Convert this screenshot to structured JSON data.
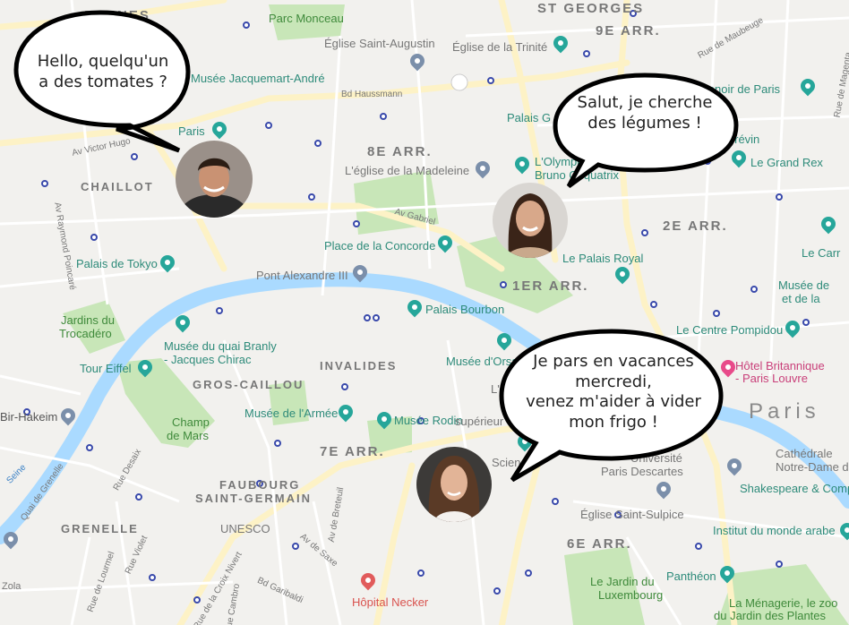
{
  "districts": {
    "ternes": "TERNES",
    "st_georges": "ST GEORGES",
    "arr9": "9E ARR.",
    "arr8": "8E ARR.",
    "chaillot": "CHAILLOT",
    "arr2": "2E ARR.",
    "arr1": "1ER ARR.",
    "invalides": "INVALIDES",
    "gros_caillou": "GROS-CAILLOU",
    "arr7": "7E ARR.",
    "faubourg1": "FAUBOURG",
    "faubourg2": "SAINT-GERMAIN",
    "grenelle": "GRENELLE",
    "arr6": "6E ARR.",
    "paris": "Paris"
  },
  "pois": {
    "parc_monceau": "Parc Monceau",
    "eglise_st_augustin": "Église Saint-Augustin",
    "eglise_trinite": "Église de la Trinité",
    "musee_jacquemart": "Musée Jacquemart-André",
    "bd_haussmann": "Bd Haussmann",
    "opera": "Palais G",
    "madeleine": "L'église de la Madeleine",
    "olympia1": "L'Olympia",
    "olympia2": "Bruno Coquatrix",
    "grevin": "Grévin",
    "grand_rex": "Le Grand Rex",
    "manoir": "Manoir de Paris",
    "place_concorde": "Place de la Concorde",
    "palais_royal": "Le Palais Royal",
    "palais_tokyo": "Palais de Tokyo",
    "pont_alexandre": "Pont Alexandre III",
    "palais_bourbon": "Palais Bourbon",
    "jardins_troca1": "Jardins du",
    "jardins_troca2": "Trocadéro",
    "quai_branly1": "Musée du quai Branly",
    "quai_branly2": "- Jacques Chirac",
    "musee_orsay": "Musée d'Orsay",
    "tour_eiffel": "Tour Eiffel",
    "centre_pompidou": "Le Centre Pompidou",
    "hotel_britannique1": "Hôtel Britannique",
    "hotel_britannique2": "- Paris Louvre",
    "musee_armee": "Musée de l'Armée",
    "musee_rodin": "Musée Rodin",
    "champ_mars1": "Champ",
    "champ_mars2": "de Mars",
    "bir_hakeim": "Bir-Hakeim",
    "universite1": "Université",
    "universite2": "Paris Descartes",
    "cathedrale1": "Cathédrale",
    "cathedrale2": "Notre-Dame de",
    "shakespeare": "Shakespeare & Company",
    "unesco": "UNESCO",
    "eglise_sulpice": "Église Saint-Sulpice",
    "institut_monde": "Institut du monde arabe",
    "pantheon": "Panthéon",
    "jardin_lux1": "Le Jardin du",
    "jardin_lux2": "Luxembourg",
    "hopital": "Hôpital Necker",
    "menagerie1": "La Ménagerie, le zoo",
    "menagerie2": "du Jardin des Plantes",
    "musee_cluny1": "Musée de",
    "musee_cluny2": "et de la",
    "le_carr": "Le Carr",
    "paris_poi": "Paris",
    "superieur": "supérieur",
    "scienc": "Scienc",
    "le_e": "L'É"
  },
  "roads": {
    "av_victor_hugo": "Av Victor Hugo",
    "av_raymond": "Av Raymond Poincaré",
    "av_gabriel": "Av Gabriel",
    "rue_maubeuge": "Rue de Maubeuge",
    "quai_grenelle": "Quai de Grenelle",
    "rue_desaix": "Rue Desaix",
    "rue_lourmel": "Rue de Lourmel",
    "rue_violet": "Rue Violet",
    "rue_croix_nivert": "Rue de la Croix Nivert",
    "rue_cambronne": "Rue Cambro",
    "bd_garibaldi": "Bd Garibaldi",
    "av_saxe": "Av de Saxe",
    "av_breteuil": "Av de Breteuil",
    "seine": "Seine",
    "zola": "Zola",
    "rue_magenta": "Rue de Magenta"
  },
  "bubbles": {
    "b1": "Hello, quelqu'un\na des tomates ?",
    "b2": "Salut, je cherche\ndes légumes !",
    "b3": "Je pars en vacances\nmercredi,\nvenez m'aider à vider\nmon frigo !"
  },
  "colors": {
    "land": "#f2f1ee",
    "water": "#aadaff",
    "park": "#c8e6b8",
    "road": "#ffffff",
    "major_road": "#fdf2c6",
    "district_text": "#777777",
    "poi_teal": "#2e8b7a"
  }
}
